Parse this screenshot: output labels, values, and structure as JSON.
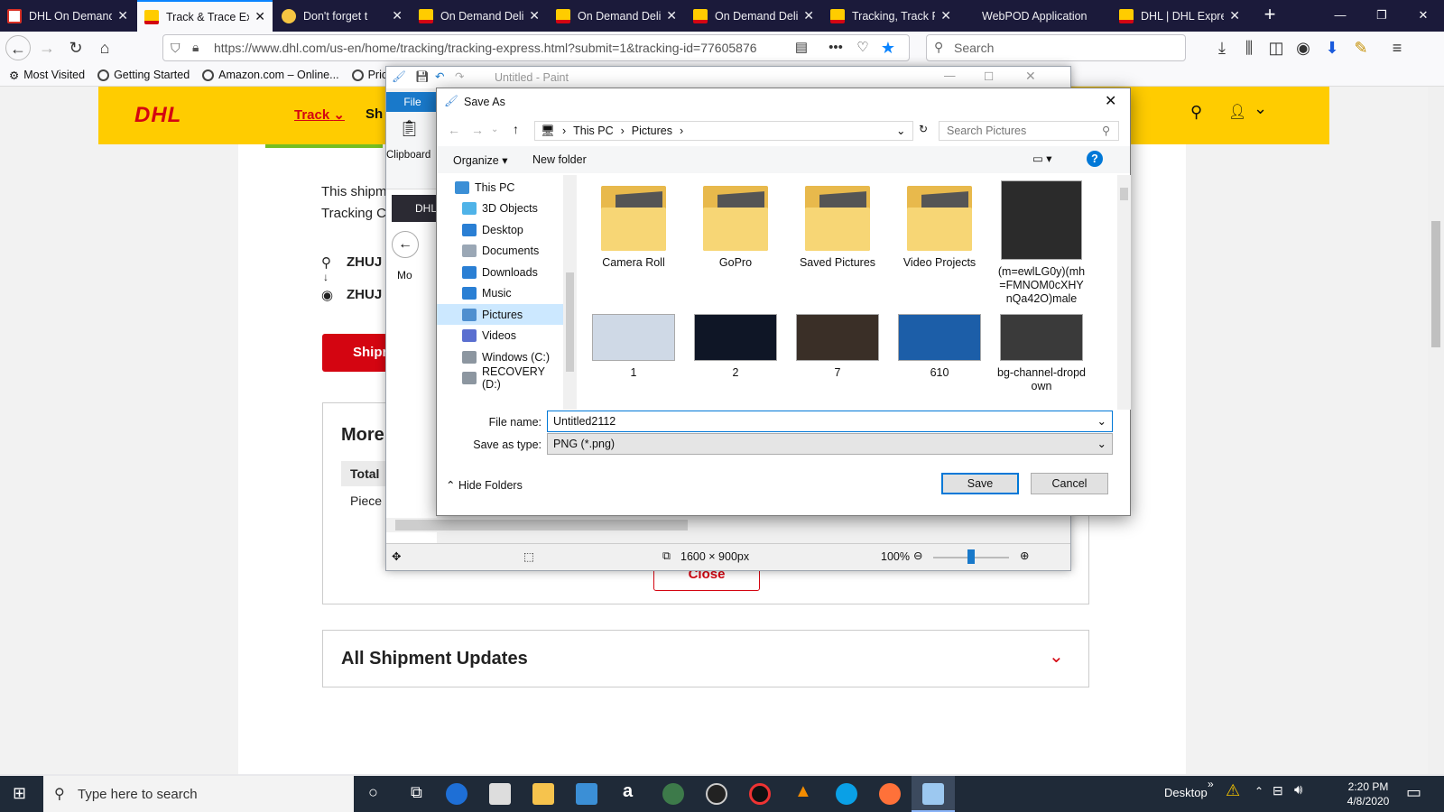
{
  "browser": {
    "tabs": [
      {
        "label": "DHL On Demand",
        "icon": "gmail-icon",
        "active": false
      },
      {
        "label": "Track & Trace Exp",
        "icon": "dhl-icon",
        "active": true
      },
      {
        "label": "Don't forget t",
        "icon": "smiley-icon",
        "active": false
      },
      {
        "label": "On Demand Deliv",
        "icon": "dhl-icon",
        "active": false
      },
      {
        "label": "On Demand Deliv",
        "icon": "dhl-icon",
        "active": false
      },
      {
        "label": "On Demand Deliv",
        "icon": "dhl-icon",
        "active": false
      },
      {
        "label": "Tracking, Track Pa",
        "icon": "dhl-icon",
        "active": false
      },
      {
        "label": "WebPOD Application",
        "icon": "none",
        "active": false
      },
      {
        "label": "DHL | DHL Expre",
        "icon": "dhl-icon",
        "active": false
      }
    ],
    "url": "https://www.dhl.com/us-en/home/tracking/tracking-express.html?submit=1&tracking-id=77605876",
    "search_placeholder": "Search",
    "bookmarks": [
      "Most Visited",
      "Getting Started",
      "Amazon.com – Online...",
      "Pricel"
    ]
  },
  "dhl_page": {
    "logo": "DHL",
    "nav_track": "Track",
    "nav_partial": "Sh",
    "shipment_text_1": "This shipm",
    "shipment_text_2": "Tracking C",
    "origin": "ZHUJ",
    "destination": "ZHUJ",
    "ship_button": "Shipm",
    "more_title": "More",
    "total_label": "Total",
    "piece_label": "Piece",
    "close_button": "Close",
    "updates_title": "All Shipment Updates"
  },
  "paint": {
    "title": "Untitled - Paint",
    "file_tab": "File",
    "clipboard_label": "Clipboard",
    "inner_tab": "DHL",
    "inner_bookmark": "Mo",
    "canvas_size": "1600 × 900px",
    "zoom": "100%",
    "zoom_level": 0.5
  },
  "save_dialog": {
    "title": "Save As",
    "breadcrumb": [
      "This PC",
      "Pictures"
    ],
    "search_placeholder": "Search Pictures",
    "organize": "Organize",
    "new_folder": "New folder",
    "nav_items": [
      {
        "label": "This PC",
        "icon": "pc-icon",
        "selected": false
      },
      {
        "label": "3D Objects",
        "icon": "3d-objects-icon",
        "selected": false
      },
      {
        "label": "Desktop",
        "icon": "desktop-icon",
        "selected": false
      },
      {
        "label": "Documents",
        "icon": "documents-icon",
        "selected": false
      },
      {
        "label": "Downloads",
        "icon": "downloads-icon",
        "selected": false
      },
      {
        "label": "Music",
        "icon": "music-icon",
        "selected": false
      },
      {
        "label": "Pictures",
        "icon": "pictures-icon",
        "selected": true
      },
      {
        "label": "Videos",
        "icon": "videos-icon",
        "selected": false
      },
      {
        "label": "Windows (C:)",
        "icon": "drive-icon",
        "selected": false
      },
      {
        "label": "RECOVERY (D:)",
        "icon": "drive-icon",
        "selected": false
      }
    ],
    "files_row1": [
      {
        "label": "Camera Roll",
        "kind": "folder"
      },
      {
        "label": "GoPro",
        "kind": "folder"
      },
      {
        "label": "Saved Pictures",
        "kind": "folder"
      },
      {
        "label": "Video Projects",
        "kind": "folder"
      },
      {
        "label": "(m=ewlLG0y)(mh=FMNOM0cXHYnQa42O)male",
        "kind": "image"
      }
    ],
    "files_row2": [
      {
        "label": "1",
        "kind": "image"
      },
      {
        "label": "2",
        "kind": "image"
      },
      {
        "label": "7",
        "kind": "image"
      },
      {
        "label": "610",
        "kind": "image"
      },
      {
        "label": "bg-channel-dropdown",
        "kind": "image"
      }
    ],
    "file_name_label": "File name:",
    "file_name_value": "Untitled2112",
    "save_type_label": "Save as type:",
    "save_type_value": "PNG (*.png)",
    "hide_folders": "Hide Folders",
    "save_button": "Save",
    "cancel_button": "Cancel"
  },
  "taskbar": {
    "search_placeholder": "Type here to search",
    "desktop_label": "Desktop",
    "time": "2:20 PM",
    "date": "4/8/2020"
  },
  "colors": {
    "dhl_yellow": "#ffcc00",
    "dhl_red": "#d40511",
    "accent_blue": "#0078d7",
    "tabbar": "#1b1a3a",
    "taskbar": "#1f2a38"
  }
}
